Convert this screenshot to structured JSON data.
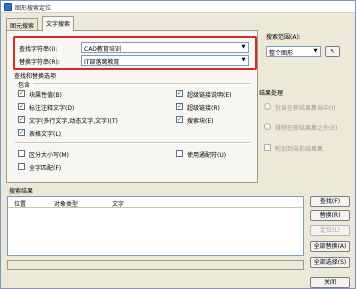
{
  "window": {
    "title": "图形搜索定位"
  },
  "tabs": [
    {
      "label": "图元搜索"
    },
    {
      "label": "文字搜索"
    }
  ],
  "find": {
    "label": "查找字符串(I):",
    "value": "CAD教育培训"
  },
  "replace": {
    "label": "替换字符串(R):",
    "value": "IT部落窝教育"
  },
  "options": {
    "group_label": "查找和替换选项",
    "include_label": "包含",
    "checkboxes": [
      {
        "label": "块属性值(B)",
        "checked": true
      },
      {
        "label": "标注注释文字(D)",
        "checked": true
      },
      {
        "label": "文字(多行文字,动态文字,文字)(T)",
        "checked": true
      },
      {
        "label": "表格文字(L)",
        "checked": true
      },
      {
        "label": "超级链接说明(E)",
        "checked": true
      },
      {
        "label": "超级链接(R)",
        "checked": true
      },
      {
        "label": "搜索块(E)",
        "checked": true
      },
      {
        "label": "区分大小写(M)",
        "checked": false
      },
      {
        "label": "全字匹配(F)",
        "checked": false
      },
      {
        "label": "使用通配符(U)",
        "checked": false
      }
    ]
  },
  "search_scope": {
    "label": "搜索范围(A):",
    "value": "整个图形"
  },
  "result_processing": {
    "label": "结果处理",
    "radios": [
      {
        "label": "包含在新结果集当中(I)"
      },
      {
        "label": "排除在新结果集之外(E)"
      }
    ],
    "append_label": "附加到当前结果集"
  },
  "results": {
    "label": "搜索结果",
    "columns": [
      "位置",
      "对象类型",
      "文字"
    ]
  },
  "buttons": {
    "find": "查找(F)",
    "replace": "替换(R)",
    "locate": "定位(L)",
    "replace_all": "全部替换(A)",
    "select_all": "全部选择(S)",
    "close": "关闭"
  }
}
